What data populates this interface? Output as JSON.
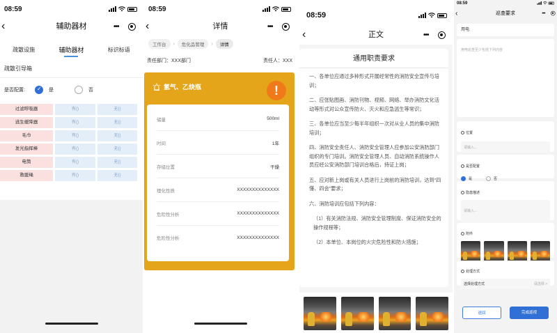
{
  "colors": {
    "accent": "#2f6fd6",
    "gold": "#e4a51a",
    "warning": "#f07a1a",
    "pink_cell": "#fbe0e0",
    "blue_cell": "#e4eef8"
  },
  "phone1": {
    "time": "08:59",
    "title": "辅助器材",
    "tabs": [
      "疏散设施",
      "辅助器材",
      "标识标语"
    ],
    "item_name": "疏散引导箱",
    "config_label": "是否配置:",
    "opt_yes": "是",
    "opt_no": "否",
    "rows": [
      {
        "name": "过滤呼吸器",
        "has": "有()",
        "none": "无()"
      },
      {
        "name": "逃生缓降器",
        "has": "有()",
        "none": "无()"
      },
      {
        "name": "毛巾",
        "has": "有()",
        "none": "无()"
      },
      {
        "name": "发光指挥棒",
        "has": "有()",
        "none": "无()"
      },
      {
        "name": "电筒",
        "has": "有()",
        "none": "无()"
      },
      {
        "name": "救援绳",
        "has": "有()",
        "none": "无()"
      }
    ]
  },
  "phone2": {
    "time": "08:59",
    "title": "详情",
    "crumbs": [
      "工作台",
      "危化品管理",
      "详情"
    ],
    "dept": "责任部门：XXX部门",
    "person": "责任人：XXX",
    "card_title": "氢气、乙炔瓶",
    "warn_mark": "!",
    "fields": [
      {
        "k": "储量",
        "v": "500ml"
      },
      {
        "k": "时间",
        "v": "1年"
      },
      {
        "k": "存储位置",
        "v": "干燥"
      },
      {
        "k": "理化性质",
        "v": "XXXXXXXXXXXXXX"
      },
      {
        "k": "危险性分析",
        "v": "XXXXXXXXXXXXXX"
      },
      {
        "k": "危险性分析",
        "v": "XXXXXXXXXXXXXX"
      }
    ]
  },
  "phone3": {
    "time": "08:59",
    "title": "正文",
    "doc_title": "通用职责要求",
    "paras": [
      "一、各单位应通过多种形式开展经常性的消防安全宣传与培训；",
      "二、应张贴图画、消防刊物、视频、网络、举办消防文化活动等形式对公众宣传防火、灭火和应急逃生等常识；",
      "三、各单位应当至少每半年组织一次对从业人员的集中消防培训；",
      "四、消防安全责任人、消防安全管理人应参加公安消防部门组织的专门培训。消防安全管理人员、自动消防系统操作人员应经公安消防部门培训合格后，持证上岗；",
      "五、应对新上岗或有关人员进行上岗前的消防培训，达到“四懂、四会”要求；",
      "六、消防培训应包括下列内容：",
      "（1）有关消防法规、消防安全管理制度、保证消防安全的操作规程等；",
      "（2）本单位、本岗位的火灾危险性和防火措施；"
    ]
  },
  "phone4": {
    "time": "08:59",
    "title": "巡查要求",
    "field_title": "用电",
    "area_placeholder": "用电巡查至少包括下列内容",
    "loc_label": "位置",
    "loc_placeholder": "请输入...",
    "cfg_label": "是否配置",
    "cfg_yes": "是",
    "cfg_no": "否",
    "desc_label": "隐患描述",
    "desc_placeholder": "请输入...",
    "att_label": "附件",
    "proc_label": "处理方式",
    "proc_select": "选择处理方式",
    "proc_placeholder": "请选择 >",
    "btn_return": "退回",
    "btn_done": "完成巡视"
  }
}
